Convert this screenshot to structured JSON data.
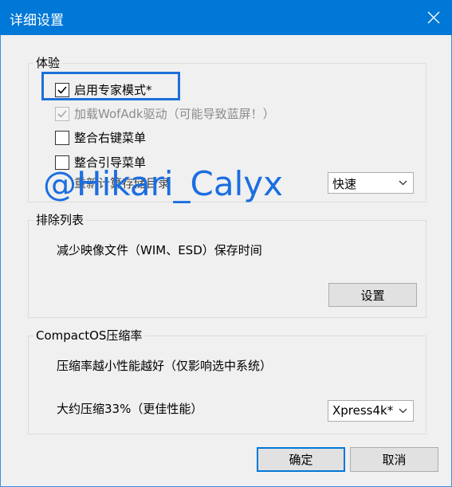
{
  "window": {
    "title": "详细设置",
    "close_icon": "close-icon"
  },
  "experience": {
    "legend": "体验",
    "items": [
      {
        "label": "启用专家模式*",
        "checked": true,
        "disabled": false
      },
      {
        "label": "加载WofAdk驱动（可能导致蓝屏！）",
        "checked": true,
        "disabled": true
      },
      {
        "label": "整合右键菜单",
        "checked": false,
        "disabled": false
      },
      {
        "label": "整合引导菜单",
        "checked": false,
        "disabled": false
      }
    ],
    "occluded_label": "重新计算存储目录",
    "speed_select": "快速"
  },
  "exclude": {
    "legend": "排除列表",
    "description": "减少映像文件（WIM、ESD）保存时间",
    "settings_button": "设置"
  },
  "compact": {
    "legend": "CompactOS压缩率",
    "hint": "压缩率越小性能越好（仅影响选中系统）",
    "ratio_label": "大约压缩33%（更佳性能）",
    "algorithm_select": "Xpress4k*"
  },
  "footer": {
    "ok": "确定",
    "cancel": "取消"
  },
  "watermark": "@Hikari_Calyx",
  "colors": {
    "titlebar": "#0078d7",
    "highlight": "#1e6fd9",
    "watermark": "#1a6ee0"
  }
}
